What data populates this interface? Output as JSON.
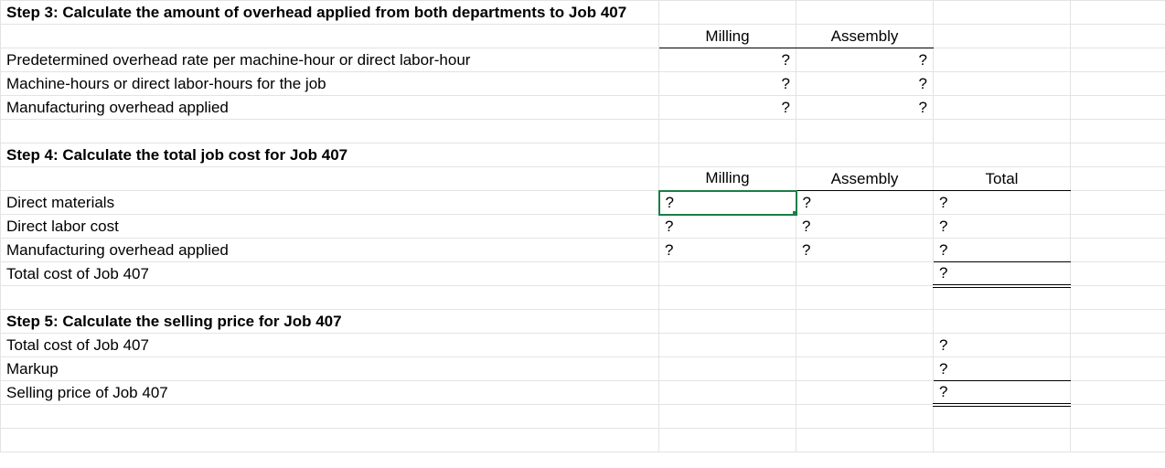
{
  "step3": {
    "title": "Step 3: Calculate the amount of overhead applied from both departments to Job 407",
    "headers": {
      "milling": "Milling",
      "assembly": "Assembly"
    },
    "rows": [
      {
        "label": "Predetermined overhead rate per machine-hour or direct labor-hour",
        "milling": "?",
        "assembly": "?"
      },
      {
        "label": "Machine-hours or direct labor-hours for the job",
        "milling": "?",
        "assembly": "?"
      },
      {
        "label": "Manufacturing overhead applied",
        "milling": "?",
        "assembly": "?"
      }
    ]
  },
  "step4": {
    "title": "Step 4: Calculate the total job cost for Job 407",
    "headers": {
      "milling": "Milling",
      "assembly": "Assembly",
      "total": "Total"
    },
    "rows": [
      {
        "label": "Direct materials",
        "milling": "?",
        "assembly": "?",
        "total": "?"
      },
      {
        "label": "Direct labor cost",
        "milling": "?",
        "assembly": "?",
        "total": "?"
      },
      {
        "label": "Manufacturing overhead applied",
        "milling": "?",
        "assembly": "?",
        "total": "?"
      },
      {
        "label": "Total cost of Job 407",
        "total": "?"
      }
    ]
  },
  "step5": {
    "title": "Step 5: Calculate the selling price for Job 407",
    "rows": [
      {
        "label": "Total cost of Job 407",
        "total": "?"
      },
      {
        "label": "Markup",
        "total": "?"
      },
      {
        "label": "Selling price of Job 407",
        "total": "?"
      }
    ]
  }
}
